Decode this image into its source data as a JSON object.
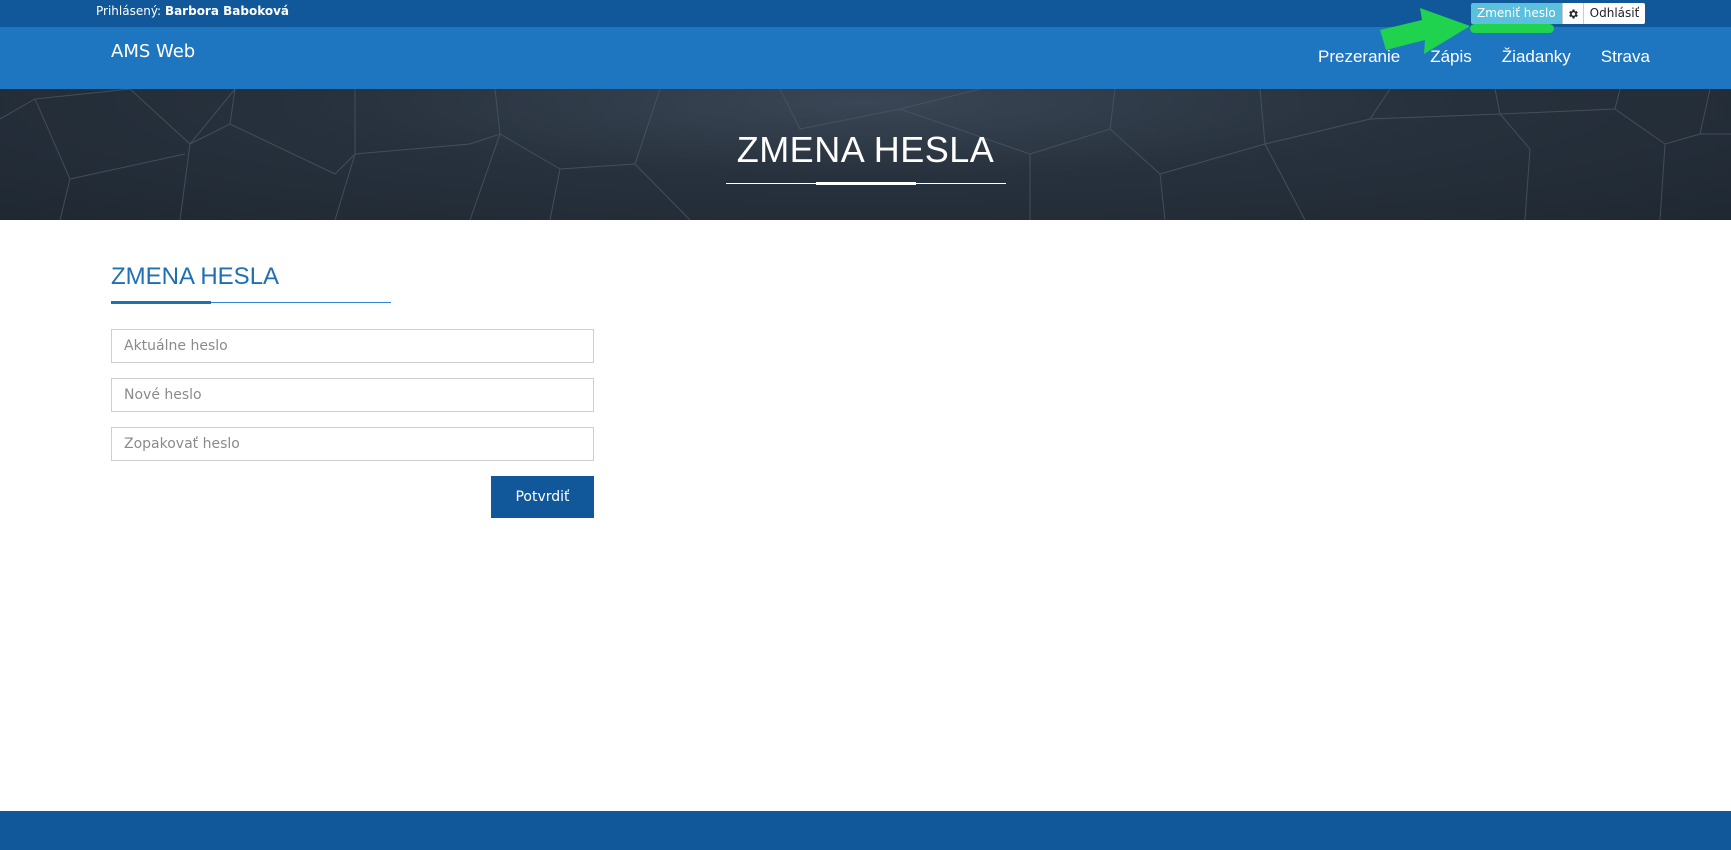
{
  "topbar": {
    "logged_label": "Prihlásený:",
    "user_name": "Barbora Baboková",
    "change_password_label": "Zmeniť heslo",
    "gear_icon": "gear-icon",
    "logout_label": "Odhlásiť"
  },
  "navbar": {
    "brand": "AMS Web",
    "items": [
      {
        "label": "Prezeranie"
      },
      {
        "label": "Zápis"
      },
      {
        "label": "Žiadanky"
      },
      {
        "label": "Strava"
      }
    ]
  },
  "hero": {
    "title": "ZMENA HESLA"
  },
  "form": {
    "title": "ZMENA HESLA",
    "current_password_placeholder": "Aktuálne heslo",
    "new_password_placeholder": "Nové heslo",
    "repeat_password_placeholder": "Zopakovať heslo",
    "submit_label": "Potvrdiť"
  },
  "colors": {
    "topbar": "#11589b",
    "navbar": "#1f76c0",
    "hero": "#27313d",
    "accent": "#1f6fb5",
    "highlight_button": "#5bc0de",
    "annotation": "#1fd34e"
  }
}
